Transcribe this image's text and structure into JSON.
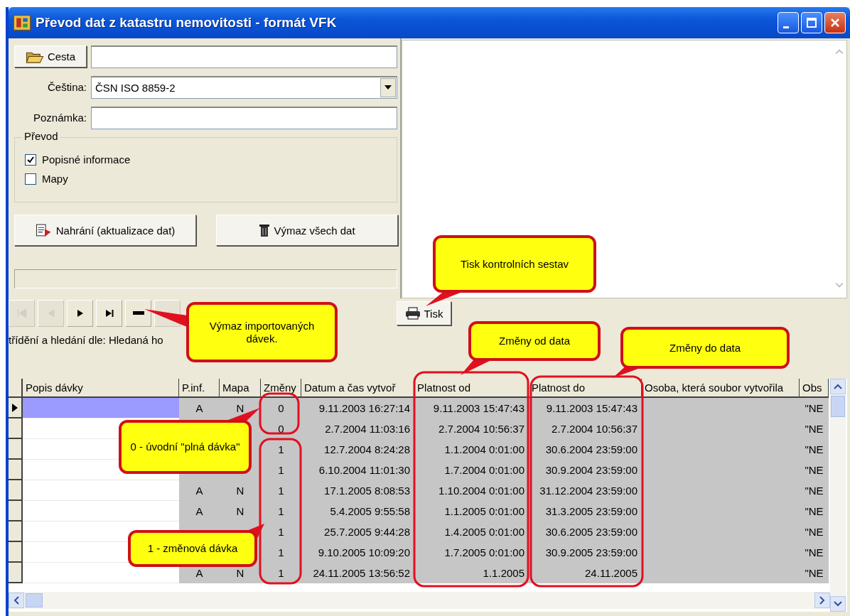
{
  "window": {
    "title": "Převod dat z katastru nemovitosti - formát VFK"
  },
  "form": {
    "path_button": "Cesta",
    "encoding_label": "Čeština:",
    "encoding_value": "ČSN ISO 8859-2",
    "note_label": "Poznámka:",
    "group_title": "Převod",
    "options": [
      {
        "label": "Popisné informace",
        "checked": true
      },
      {
        "label": "Mapy",
        "checked": false
      }
    ],
    "buttons": [
      {
        "label": "Nahrání  (aktualizace dat)",
        "kind": "upload"
      },
      {
        "label": "Výmaz všech dat",
        "kind": "delete"
      }
    ]
  },
  "navigator": [
    {
      "kind": "first",
      "disabled": true
    },
    {
      "kind": "prior",
      "disabled": true
    },
    {
      "kind": "next",
      "disabled": false
    },
    {
      "kind": "last",
      "disabled": false
    },
    {
      "kind": "delete",
      "disabled": false
    },
    {
      "kind": "blank",
      "disabled": true
    }
  ],
  "print_button": "Tisk",
  "search_label": "třídění a hledání dle: Hledaná ho",
  "grid": {
    "columns": [
      "Popis dávky",
      "P.inf.",
      "Mapa",
      "Změny",
      "Datum a čas vytvoř",
      "Platnost od",
      "Platnost do",
      "Osoba, která soubor vytvořila",
      "Obs"
    ],
    "rows": [
      {
        "selected": true,
        "p_inf": "A",
        "mapa": "N",
        "changes": "0",
        "created": "9.11.2003 16:27:14",
        "valid_from": "9.11.2003 15:47:43",
        "valid_to": "9.11.2003 15:47:43",
        "content": "\"NE"
      },
      {
        "selected": false,
        "changes": "0",
        "created": "2.7.2004 11:03:16",
        "valid_from": "2.7.2004 10:56:37",
        "valid_to": "2.7.2004 10:56:37",
        "content": "\"NE"
      },
      {
        "selected": false,
        "changes": "1",
        "created": "12.7.2004 8:24:28",
        "valid_from": "1.1.2004 0:01:00",
        "valid_to": "30.6.2004 23:59:00",
        "content": "\"NE"
      },
      {
        "selected": false,
        "changes": "1",
        "created": "6.10.2004 11:01:30",
        "valid_from": "1.7.2004 0:01:00",
        "valid_to": "30.9.2004 23:59:00",
        "content": "\"NE"
      },
      {
        "selected": false,
        "p_inf": "A",
        "mapa": "N",
        "changes": "1",
        "created": "17.1.2005 8:08:53",
        "valid_from": "1.10.2004 0:01:00",
        "valid_to": "31.12.2004 23:59:00",
        "content": "\"NE"
      },
      {
        "selected": false,
        "p_inf": "A",
        "mapa": "N",
        "changes": "1",
        "created": "5.4.2005 9:55:58",
        "valid_from": "1.1.2005 0:01:00",
        "valid_to": "31.3.2005 23:59:00",
        "content": "\"NE"
      },
      {
        "selected": false,
        "changes": "1",
        "created": "25.7.2005 9:44:28",
        "valid_from": "1.4.2005 0:01:00",
        "valid_to": "30.6.2005 23:59:00",
        "content": "\"NE"
      },
      {
        "selected": false,
        "changes": "1",
        "created": "9.10.2005 10:09:20",
        "valid_from": "1.7.2005 0:01:00",
        "valid_to": "30.9.2005 23:59:00",
        "content": "\"NE"
      },
      {
        "selected": false,
        "p_inf": "A",
        "mapa": "N",
        "changes": "1",
        "created": "24.11.2005 13:56:52",
        "valid_from": "1.1.2005",
        "valid_to": "24.11.2005",
        "content": "\"NE"
      }
    ]
  },
  "callouts": [
    {
      "text": "Tisk kontrolních sestav"
    },
    {
      "text": "Výmaz importovaných dávek."
    },
    {
      "text": "Změny od data"
    },
    {
      "text": "Změny do data"
    },
    {
      "text": "0 - úvodní \"plná dávka\""
    },
    {
      "text": "1 - změnová dávka"
    }
  ]
}
